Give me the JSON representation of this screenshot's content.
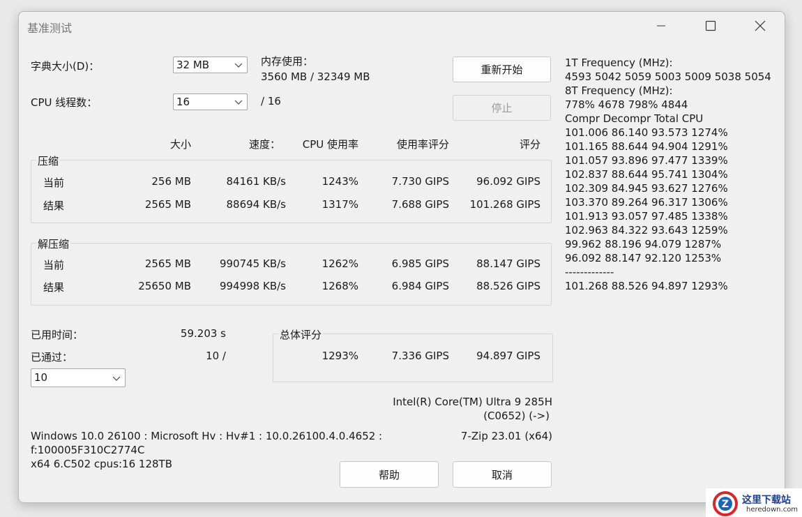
{
  "window": {
    "title": "基准测试"
  },
  "settings": {
    "dict_label": "字典大小(D)：",
    "dict_value": "32 MB",
    "threads_label": "CPU 线程数：",
    "threads_value": "16",
    "threads_max": "/ 16",
    "mem_label": "内存使用：",
    "mem_value": "3560 MB / 32349 MB"
  },
  "buttons": {
    "restart": "重新开始",
    "stop": "停止",
    "help": "帮助",
    "cancel": "取消"
  },
  "columns": [
    "大小",
    "速度：",
    "CPU 使用率",
    "使用率评分",
    "评分"
  ],
  "compress": {
    "label": "压缩",
    "rows": [
      [
        "当前",
        "256 MB",
        "84161 KB/s",
        "1243%",
        "7.730 GIPS",
        "96.092 GIPS"
      ],
      [
        "结果",
        "2565 MB",
        "88694 KB/s",
        "1317%",
        "7.688 GIPS",
        "101.268 GIPS"
      ]
    ]
  },
  "decompress": {
    "label": "解压缩",
    "rows": [
      [
        "当前",
        "2565 MB",
        "990745 KB/s",
        "1262%",
        "6.985 GIPS",
        "88.147 GIPS"
      ],
      [
        "结果",
        "25650 MB",
        "994998 KB/s",
        "1268%",
        "6.984 GIPS",
        "88.526 GIPS"
      ]
    ]
  },
  "elapsed": {
    "label": "已用时间：",
    "value": "59.203 s"
  },
  "passes": {
    "label": "已通过：",
    "value": "10 /",
    "select": "10"
  },
  "total": {
    "label": "总体评分",
    "usage": "1293%",
    "rating_usage": "7.336 GIPS",
    "rating": "94.897 GIPS"
  },
  "cpu": {
    "name": "Intel(R) Core(TM) Ultra 9 285H",
    "code": "(C0652) (->)"
  },
  "sysinfo": [
    "Windows 10.0 26100 : Microsoft Hv : Hv#1 : 10.0.26100.4.0.4652 :",
    "f:100005F310C2774C",
    "x64 6.C502 cpus:16 128TB"
  ],
  "version": "7-Zip 23.01 (x64)",
  "log": [
    "1T Frequency (MHz):",
    " 4593 5042 5059 5003 5009 5038 5054",
    "8T Frequency (MHz):",
    " 778% 4678 798% 4844",
    "Compr Decompr Total   CPU",
    "101.006  86.140  93.573  1274%",
    "101.165  88.644  94.904  1291%",
    "101.057  93.896  97.477  1339%",
    "102.837  88.644  95.741  1304%",
    "102.309  84.945  93.627  1276%",
    "103.370  89.264  96.317  1306%",
    "101.913  93.057  97.485  1338%",
    "102.963  84.322  93.643  1259%",
    "99.962  88.196  94.079  1287%",
    "96.092  88.147  92.120  1253%",
    "-------------",
    "101.268  88.526  94.897  1293%"
  ],
  "watermark": {
    "main": "这里下载站",
    "sub": "heredown.com"
  }
}
